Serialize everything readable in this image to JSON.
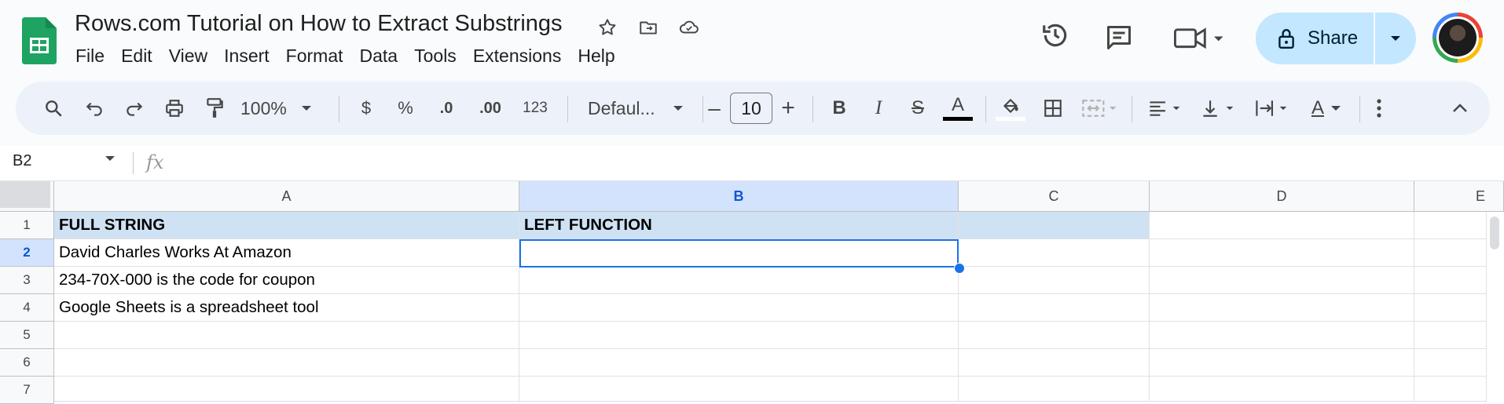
{
  "app": {
    "title": "Rows.com Tutorial on How to Extract Substrings",
    "menu": [
      "File",
      "Edit",
      "View",
      "Insert",
      "Format",
      "Data",
      "Tools",
      "Extensions",
      "Help"
    ],
    "share_label": "Share"
  },
  "toolbar": {
    "zoom": "100%",
    "currency": "$",
    "percent": "%",
    "decrease_decimal": ".0",
    "increase_decimal": ".00",
    "number_format": "123",
    "font_family": "Defaul...",
    "font_size": "10",
    "minus": "–",
    "plus": "+",
    "bold": "B",
    "italic": "I",
    "strike": "S",
    "text_color": "A",
    "text_rotation": "A"
  },
  "formula_bar": {
    "name_box": "B2",
    "fx": "fx",
    "value": ""
  },
  "sheet": {
    "columns": [
      "A",
      "B",
      "C",
      "D",
      "E"
    ],
    "rows": [
      "1",
      "2",
      "3",
      "4",
      "5",
      "6",
      "7"
    ],
    "cells": {
      "A1": "FULL STRING",
      "B1": "LEFT FUNCTION",
      "A2": "David Charles Works At Amazon",
      "A3": "234-70X-000 is the code for coupon",
      "A4": "Google Sheets is a spreadsheet tool"
    },
    "selected_cell": "B2"
  },
  "colors": {
    "accent": "#1a73e8",
    "header_fill": "#cfe2f3",
    "share_bg": "#c2e7ff"
  }
}
